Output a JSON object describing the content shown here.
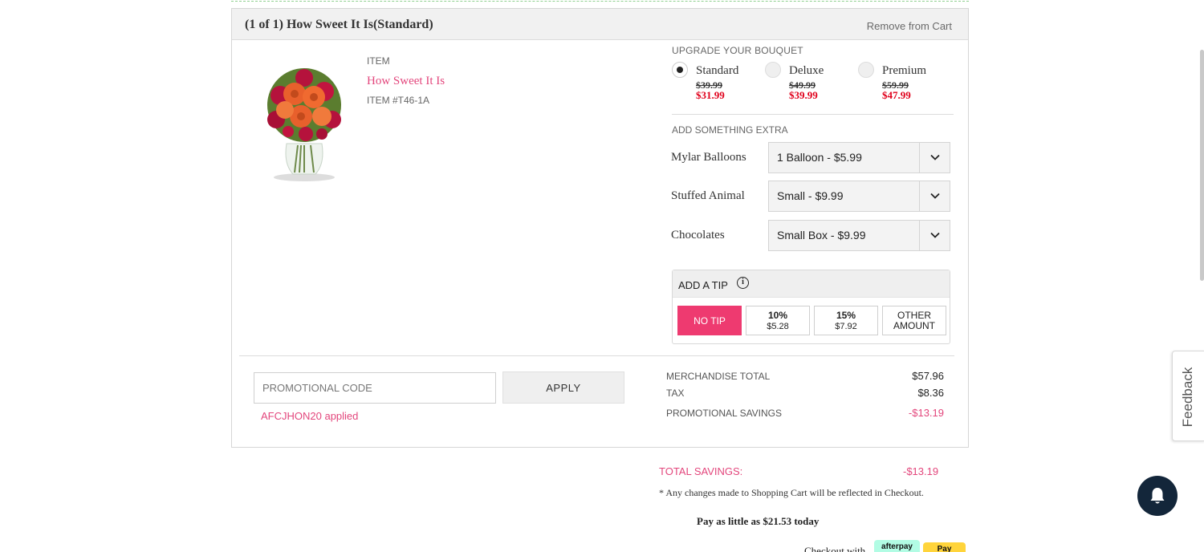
{
  "cart": {
    "title": "(1 of 1) How Sweet It Is(Standard)",
    "remove_label": "Remove from Cart",
    "item": {
      "label": "ITEM",
      "name": "How Sweet It Is",
      "number": "ITEM #T46-1A"
    },
    "upgrade": {
      "title": "UPGRADE YOUR BOUQUET",
      "options": [
        {
          "name": "Standard",
          "old_price": "$39.99",
          "new_price": "$31.99",
          "selected": true
        },
        {
          "name": "Deluxe",
          "old_price": "$49.99",
          "new_price": "$39.99",
          "selected": false
        },
        {
          "name": "Premium",
          "old_price": "$59.99",
          "new_price": "$47.99",
          "selected": false
        }
      ]
    },
    "extras": {
      "title": "ADD SOMETHING EXTRA",
      "items": [
        {
          "label": "Mylar Balloons",
          "value": "1 Balloon - $5.99"
        },
        {
          "label": "Stuffed Animal",
          "value": "Small - $9.99"
        },
        {
          "label": "Chocolates",
          "value": "Small Box - $9.99"
        }
      ]
    },
    "tip": {
      "title": "ADD A TIP",
      "info_glyph": "i",
      "no_tip": "NO TIP",
      "ten_pct": "10%",
      "ten_amt": "$5.28",
      "fifteen_pct": "15%",
      "fifteen_amt": "$7.92",
      "other_line1": "OTHER",
      "other_line2": "AMOUNT"
    },
    "promo": {
      "placeholder": "PROMOTIONAL CODE",
      "apply_label": "APPLY",
      "applied_text": "AFCJHON20 applied"
    },
    "summary": {
      "merch_label": "MERCHANDISE TOTAL",
      "merch_value": "$57.96",
      "tax_label": "TAX",
      "tax_value": "$8.36",
      "promo_label": "PROMOTIONAL SAVINGS",
      "promo_value": "-$13.19"
    }
  },
  "footer": {
    "total_savings_label": "TOTAL SAVINGS:",
    "total_savings_value": "-$13.19",
    "note": "* Any changes made to Shopping Cart will be reflected in Checkout.",
    "pay_little": "Pay as little as $21.53 today",
    "checkout_with": "Checkout with",
    "afterpay_label": "afterpay",
    "paybadge_label": "Pay"
  },
  "feedback_label": "Feedback",
  "colors": {
    "accent_pink": "#e3467c",
    "tip_active": "#ee3a70",
    "sale_red": "#e0001b",
    "bell_bg": "#13263a"
  },
  "icons": [
    "chevron-down-icon",
    "info-icon",
    "bell-icon"
  ]
}
